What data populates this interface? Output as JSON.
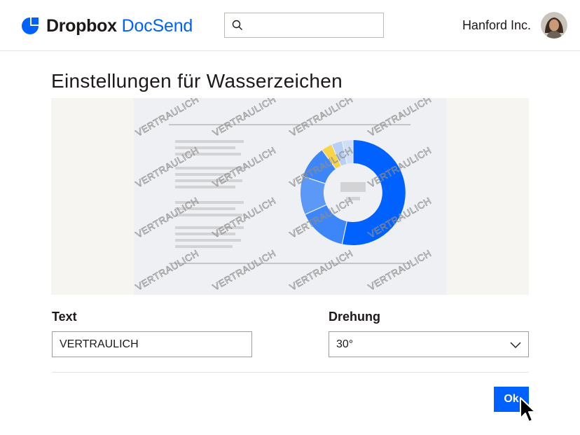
{
  "header": {
    "brand": "Dropbox",
    "product": "DocSend",
    "search_placeholder": "",
    "org_name": "Hanford Inc."
  },
  "page": {
    "title": "Einstellungen für Wasserzeichen"
  },
  "preview": {
    "watermark_text": "VERTRAULICH"
  },
  "form": {
    "text_label": "Text",
    "text_value": "VERTRAULICH",
    "rotation_label": "Drehung",
    "rotation_value": "30°",
    "ok_label": "Ok"
  },
  "colors": {
    "accent": "#0061fe",
    "donut_dark_blue": "#0061fe",
    "donut_mid_blue": "#3d86fa",
    "donut_light_blue": "#5c98f5",
    "donut_pale_blue": "#b8d0f5",
    "donut_yellow": "#f7d44c"
  }
}
